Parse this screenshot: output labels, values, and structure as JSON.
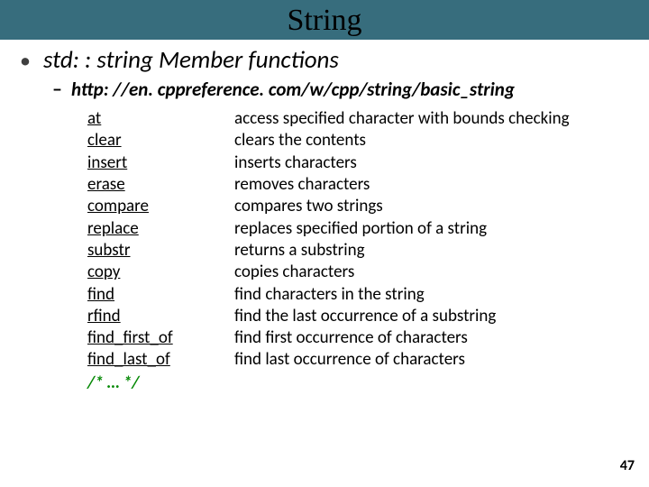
{
  "title": "String",
  "heading": "std: : string Member functions",
  "sub_link": "http: //en. cppreference. com/w/cpp/string/basic_string",
  "functions": [
    {
      "name": "at",
      "desc": "access specified character with bounds checking"
    },
    {
      "name": "clear",
      "desc": "clears the contents"
    },
    {
      "name": "insert",
      "desc": "inserts characters"
    },
    {
      "name": "erase",
      "desc": "removes characters"
    },
    {
      "name": "compare",
      "desc": "compares two strings"
    },
    {
      "name": "replace",
      "desc": "replaces specified portion of a string"
    },
    {
      "name": "substr",
      "desc": "returns a substring"
    },
    {
      "name": "copy",
      "desc": "copies characters"
    },
    {
      "name": "find",
      "desc": "find characters in the string"
    },
    {
      "name": "rfind",
      "desc": "find the last occurrence of a substring"
    },
    {
      "name": "find_first_of",
      "desc": "find first occurrence of characters"
    },
    {
      "name": "find_last_of",
      "desc": "find last occurrence of characters"
    }
  ],
  "ellipsis": "/* … */",
  "page_number": "47"
}
